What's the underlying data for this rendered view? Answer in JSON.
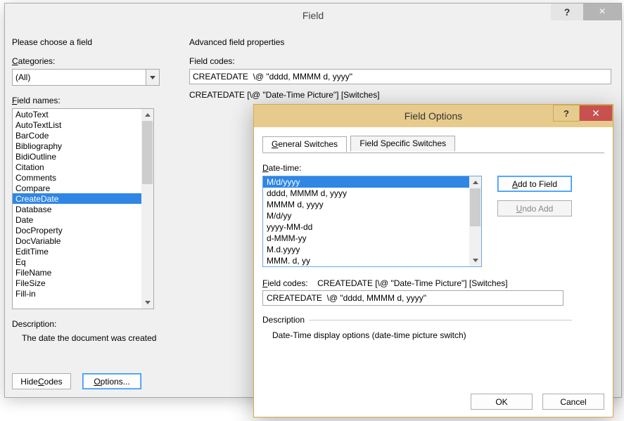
{
  "field_dialog": {
    "title": "Field",
    "help_glyph": "?",
    "close_glyph": "×",
    "choose_label": "Please choose a field",
    "categories_label_pre": "",
    "categories_label_u": "C",
    "categories_label_post": "ategories:",
    "category_selected": "(All)",
    "field_names_label_pre": "",
    "field_names_label_u": "F",
    "field_names_label_post": "ield names:",
    "field_names": [
      "AutoText",
      "AutoTextList",
      "BarCode",
      "Bibliography",
      "BidiOutline",
      "Citation",
      "Comments",
      "Compare",
      "CreateDate",
      "Database",
      "Date",
      "DocProperty",
      "DocVariable",
      "EditTime",
      "Eq",
      "FileName",
      "FileSize",
      "Fill-in"
    ],
    "field_names_selected_index": 8,
    "description_label": "Description:",
    "description_text": "The date the document was created",
    "hide_codes_pre": "Hide ",
    "hide_codes_u": "C",
    "hide_codes_post": "odes",
    "options_u": "O",
    "options_post": "ptions...",
    "adv_label": "Advanced field properties",
    "field_codes_label": "Field codes:",
    "field_codes_value": "CREATEDATE  \\@ \"dddd, MMMM d, yyyy\"",
    "syntax": "CREATEDATE [\\@ \"Date-Time Picture\"] [Switches]"
  },
  "options_dialog": {
    "title": "Field Options",
    "help_glyph": "?",
    "close_glyph": "✕",
    "tabs": {
      "general_pre": "",
      "general_u": "G",
      "general_post": "eneral Switches",
      "specific": "Field Specific Switches"
    },
    "date_time_label_u": "D",
    "date_time_label_post": "ate-time:",
    "formats": [
      "M/d/yyyy",
      "dddd, MMMM d, yyyy",
      "MMMM d, yyyy",
      "M/d/yy",
      "yyyy-MM-dd",
      "d-MMM-yy",
      "M.d.yyyy",
      "MMM. d, yy"
    ],
    "formats_selected_index": 0,
    "add_to_field_u": "A",
    "add_to_field_post": "dd to Field",
    "undo_add_u": "U",
    "undo_add_post": "ndo Add",
    "field_codes_label_u": "F",
    "field_codes_label_post": "ield codes:",
    "field_codes_hint": "CREATEDATE [\\@ \"Date-Time Picture\"] [Switches]",
    "field_codes_value": "CREATEDATE  \\@ \"dddd, MMMM d, yyyy\"",
    "desc_legend": "Description",
    "desc_text": "Date-Time display options (date-time picture switch)",
    "ok": "OK",
    "cancel": "Cancel"
  }
}
